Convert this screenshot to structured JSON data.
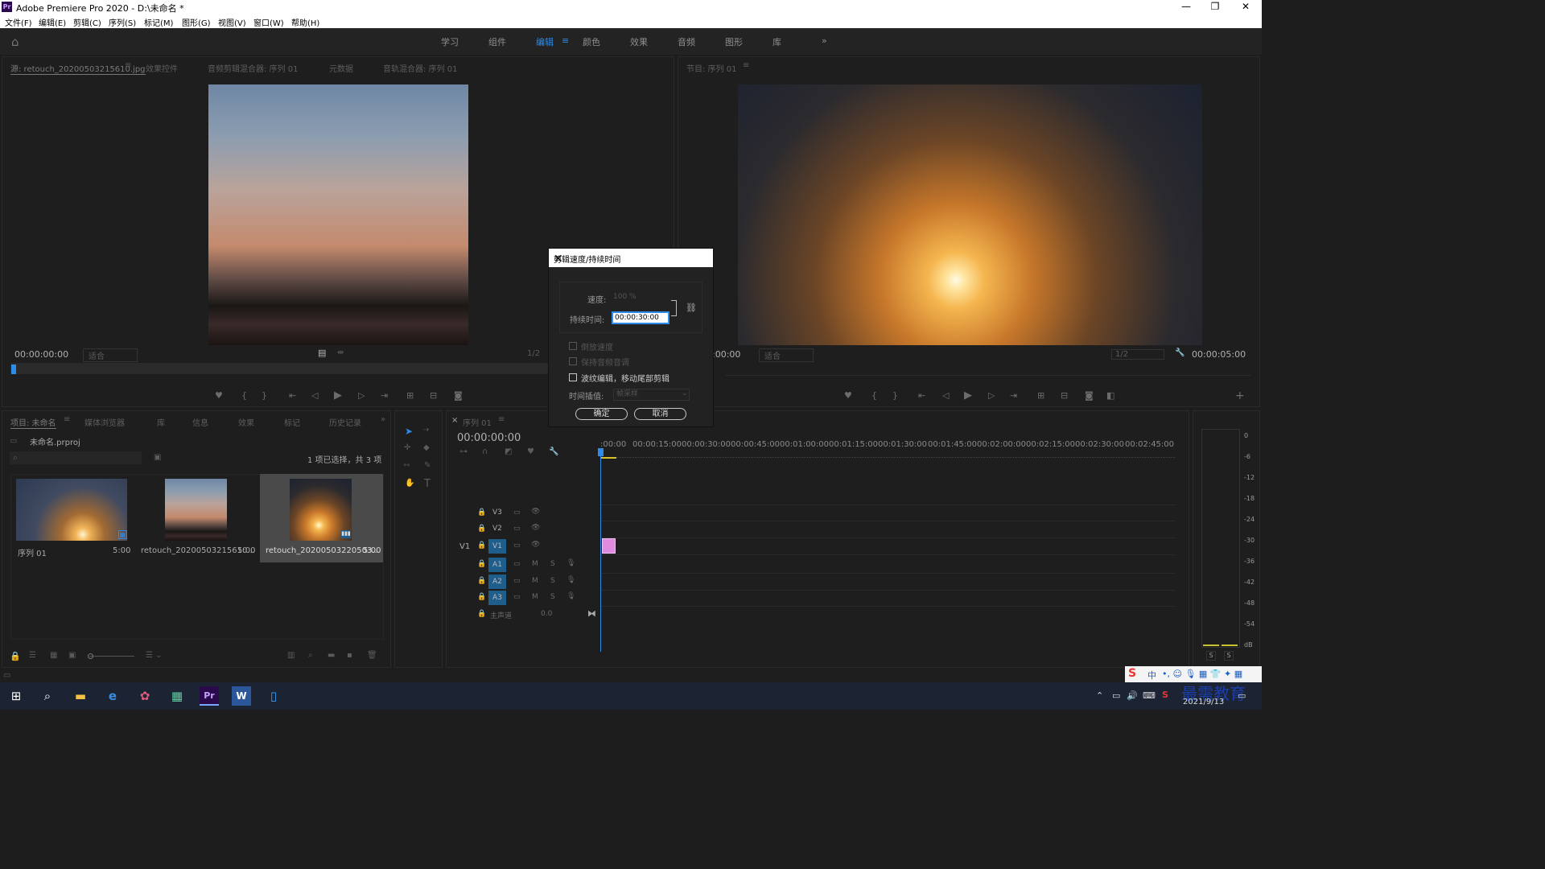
{
  "window": {
    "title": "Adobe Premiere Pro 2020 - D:\\未命名 *",
    "logo": "Pr"
  },
  "menu": [
    "文件(F)",
    "编辑(E)",
    "剪辑(C)",
    "序列(S)",
    "标记(M)",
    "图形(G)",
    "视图(V)",
    "窗口(W)",
    "帮助(H)"
  ],
  "workspaces": [
    "学习",
    "组件",
    "编辑",
    "颜色",
    "效果",
    "音频",
    "图形",
    "库"
  ],
  "workspace_more": "»",
  "source_panel": {
    "tabs": [
      "源: retouch_20200503215610.jpg",
      "效果控件",
      "音频剪辑混合器: 序列 01",
      "元数据",
      "音轨混合器: 序列 01"
    ],
    "timecode": "00:00:00:00",
    "fit": "适合",
    "ratio": "1/2"
  },
  "program_panel": {
    "tab": "节目: 序列 01",
    "timecode_left": ":00:00",
    "fit": "适合",
    "ratio": "1/2",
    "timecode_right": "00:00:05:00"
  },
  "project_panel": {
    "tabs": [
      "项目: 未命名",
      "媒体浏览器",
      "库",
      "信息",
      "效果",
      "标记",
      "历史记录"
    ],
    "file": "未命名.prproj",
    "selection": "1 项已选择，共 3 项",
    "items": [
      {
        "name": "序列 01",
        "duration": "5:00"
      },
      {
        "name": "retouch_20200503215610...",
        "duration": "5:00"
      },
      {
        "name": "retouch_20200503220503...",
        "duration": "5:00"
      }
    ]
  },
  "timeline": {
    "tab": "序列 01",
    "timecode": "00:00:00:00",
    "ruler": [
      ":00:00",
      "00:00:15:00",
      "00:00:30:00",
      "00:00:45:00",
      "00:01:00:00",
      "00:01:15:00",
      "00:01:30:00",
      "00:01:45:00",
      "00:02:00:00",
      "00:02:15:00",
      "00:02:30:00",
      "00:02:45:00"
    ],
    "video_tracks": [
      "V3",
      "V2",
      "V1"
    ],
    "audio_tracks": [
      "A1",
      "A2",
      "A3"
    ],
    "source_patch": "V1",
    "master": "主声道",
    "master_value": "0.0",
    "m_label": "M",
    "s_label": "S"
  },
  "meter": {
    "scale": [
      "0",
      "-6",
      "-12",
      "-18",
      "-24",
      "-30",
      "-36",
      "-42",
      "-48",
      "-54",
      "dB"
    ],
    "solo": [
      "S",
      "S"
    ]
  },
  "dialog": {
    "title": "剪辑速度/持续时间",
    "speed_label": "速度:",
    "speed_value": "100 %",
    "duration_label": "持续时间:",
    "duration_value": "00:00:30:00",
    "reverse": "倒放速度",
    "maintain_pitch": "保持音频音调",
    "ripple": "波纹编辑，移动尾部剪辑",
    "interp_label": "时间插值:",
    "interp_value": "帧采样",
    "ok": "确定",
    "cancel": "取消"
  },
  "taskbar": {
    "date": "2021/9/13",
    "watermark": "最需教育",
    "ime": "中"
  },
  "colors": {
    "accent": "#2d8ceb",
    "track_blue": "#1f5d8b",
    "clip": "#e08ae0",
    "playhead": "#2d8ceb"
  }
}
